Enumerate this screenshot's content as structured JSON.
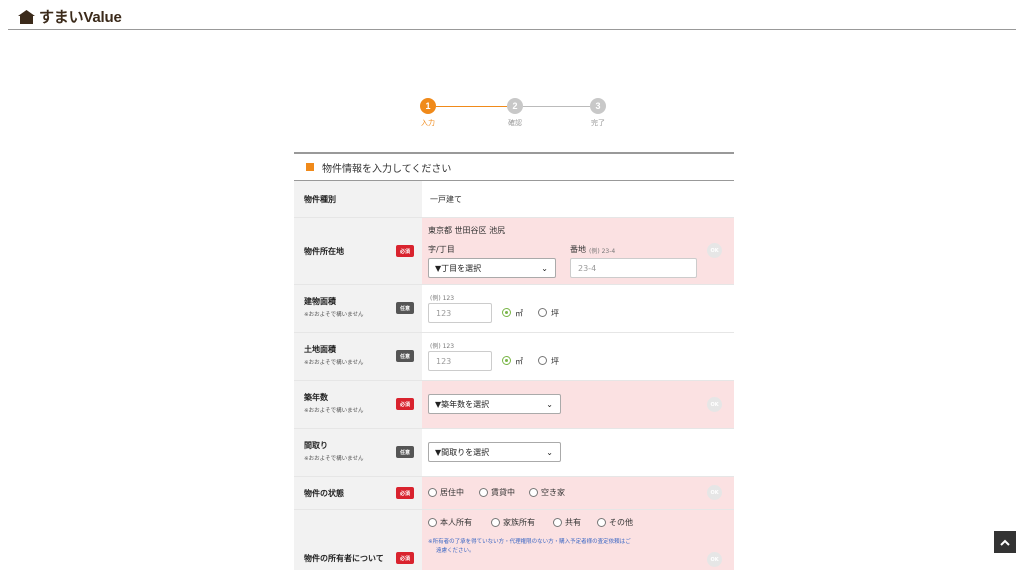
{
  "brand": {
    "name": "すまいValue",
    "color": "#3b2a1a"
  },
  "steps": [
    {
      "num": "1",
      "label": "入力",
      "active": true
    },
    {
      "num": "2",
      "label": "確認",
      "active": false
    },
    {
      "num": "3",
      "label": "完了",
      "active": false
    }
  ],
  "colors": {
    "accent": "#f08a1a",
    "required": "#d9232e",
    "optional": "#555555",
    "error_bg": "#fbe1e2",
    "radio_on": "#7ab648"
  },
  "form": {
    "heading": "物件情報を入力してください",
    "badge_required": "必須",
    "badge_optional": "任意",
    "ok_label": "OK",
    "approx_note": "※おおよそで構いません",
    "property_type": {
      "label": "物件種別",
      "value": "一戸建て"
    },
    "location": {
      "label": "物件所在地",
      "address": "東京都 世田谷区 池尻",
      "chome_label": "字/丁目",
      "chome_select": "▼丁目を選択",
      "banchi_label": "番地",
      "banchi_example": "(例) 23-4",
      "banchi_placeholder": "23-4"
    },
    "building_area": {
      "label": "建物面積",
      "example": "(例) 123",
      "placeholder": "123",
      "unit1": "㎡",
      "unit2": "坪"
    },
    "land_area": {
      "label": "土地面積",
      "example": "(例) 123",
      "placeholder": "123",
      "unit1": "㎡",
      "unit2": "坪"
    },
    "age": {
      "label": "築年数",
      "select": "▼築年数を選択"
    },
    "layout": {
      "label": "間取り",
      "select": "▼間取りを選択"
    },
    "status": {
      "label": "物件の状態",
      "options": [
        "居住中",
        "賃貸中",
        "空き家"
      ]
    },
    "owner": {
      "label": "物件の所有者について",
      "options": [
        "本人所有",
        "家族所有",
        "共有",
        "その他"
      ],
      "note_line1": "※所有者の了承を得ていない方・代理権限のない方・購入予定者様の査定依頼はご",
      "note_line2": "遠慮ください。"
    }
  },
  "scroll_top": {
    "icon": "chevron-up-icon"
  }
}
